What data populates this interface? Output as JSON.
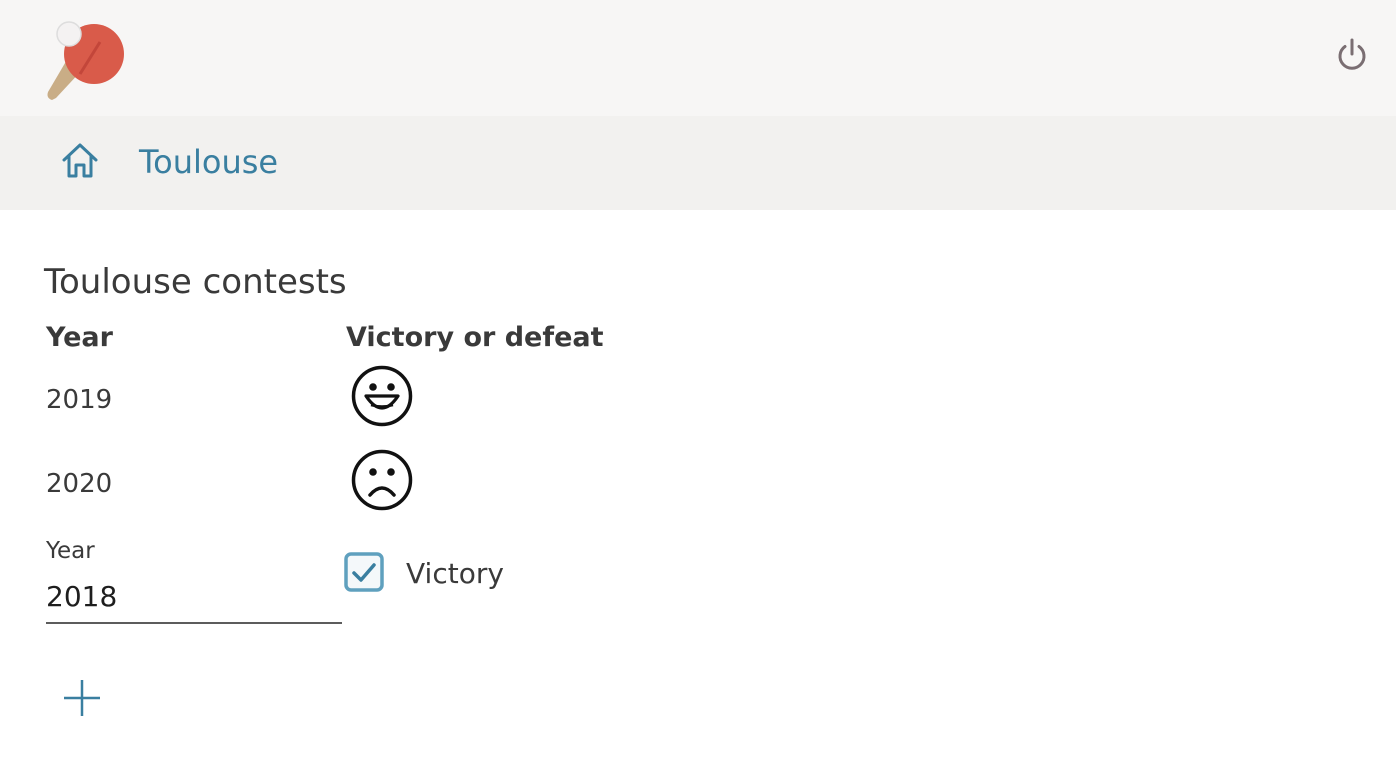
{
  "header": {
    "logo_icon": "ping-pong-paddle-icon",
    "power_icon": "power-icon"
  },
  "breadcrumb": {
    "home_icon": "home-icon",
    "current": "Toulouse"
  },
  "main": {
    "title": "Toulouse contests",
    "columns": {
      "year": "Year",
      "result": "Victory or defeat"
    },
    "rows": [
      {
        "year": "2019",
        "result": "victory",
        "icon": "smiling-face-icon"
      },
      {
        "year": "2020",
        "result": "defeat",
        "icon": "sad-face-icon"
      }
    ],
    "form": {
      "year_label": "Year",
      "year_value": "2018",
      "victory_label": "Victory",
      "victory_checked": true,
      "add_icon": "plus-icon"
    }
  },
  "colors": {
    "accent": "#3a7fa0",
    "checkbox": "#5fa0be",
    "paddle_red": "#d95b4a",
    "paddle_handle": "#c9ad86",
    "power_icon": "#7a6e72"
  }
}
